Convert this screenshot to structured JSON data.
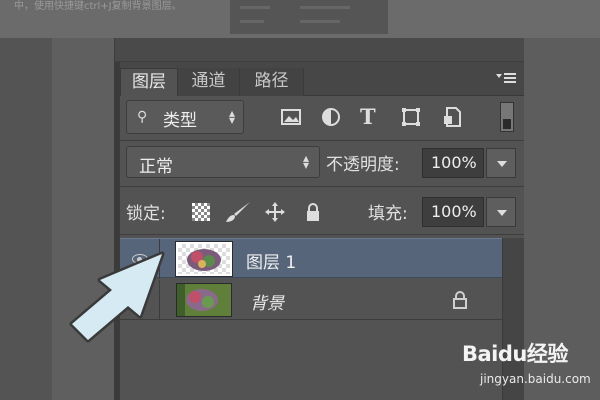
{
  "page_caption": "中，使用快捷键ctrl+J复制背景图层。",
  "panel": {
    "tabs": [
      {
        "label": "图层",
        "active": true
      },
      {
        "label": "通道",
        "active": false
      },
      {
        "label": "路径",
        "active": false
      }
    ],
    "filter": {
      "kind_label": "类型"
    },
    "filter_icons": [
      "image-filter-icon",
      "adjustment-filter-icon",
      "type-filter-icon",
      "shape-filter-icon",
      "smart-object-filter-icon"
    ],
    "blend_mode": "正常",
    "opacity_label": "不透明度:",
    "opacity_value": "100%",
    "lock_label": "锁定:",
    "fill_label": "填充:",
    "fill_value": "100%",
    "layers": [
      {
        "name": "图层 1",
        "selected": true
      },
      {
        "name": "背景",
        "selected": false,
        "locked": true
      }
    ]
  },
  "watermark": {
    "brand": "Baidu经验",
    "url": "jingyan.baidu.com"
  },
  "colors": {
    "selected_row": "#566579",
    "panel_bg": "#535353",
    "arrow": "#d6eaf4"
  }
}
